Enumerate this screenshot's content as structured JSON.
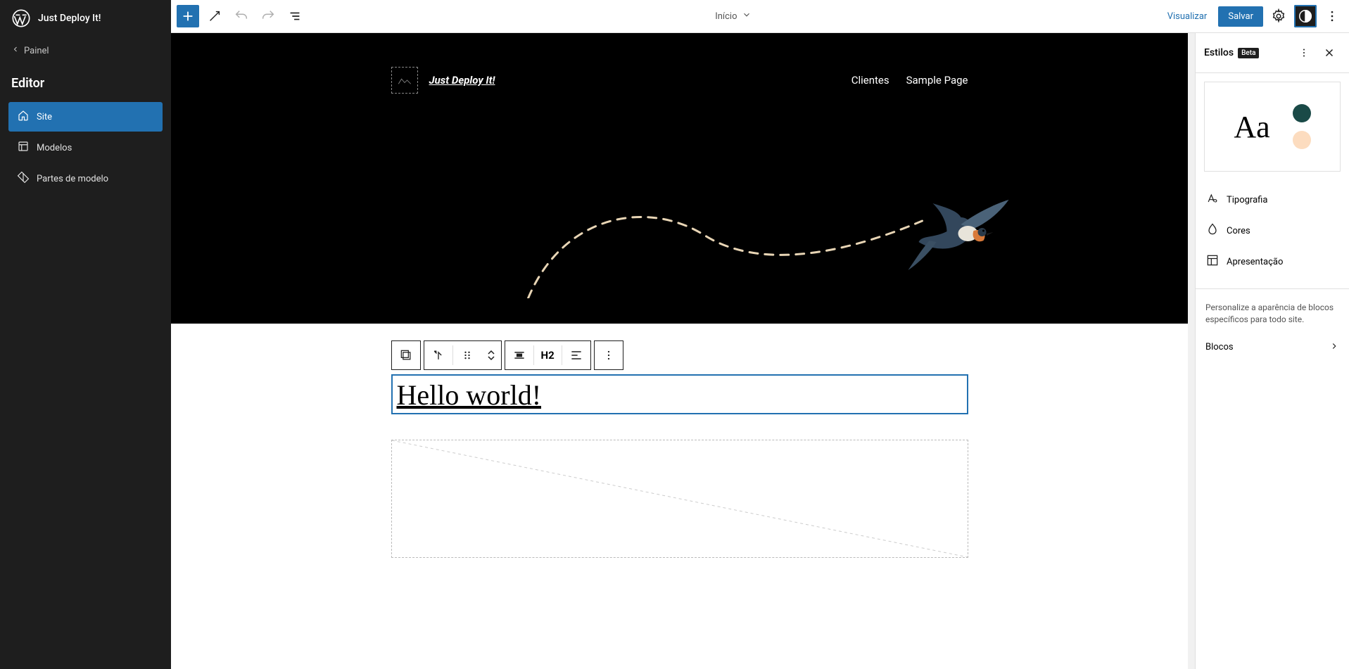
{
  "siteName": "Just Deploy It!",
  "backLabel": "Painel",
  "sectionTitle": "Editor",
  "nav": [
    {
      "label": "Site"
    },
    {
      "label": "Modelos"
    },
    {
      "label": "Partes de modelo"
    }
  ],
  "topbar": {
    "templateName": "Início",
    "preview": "Visualizar",
    "save": "Salvar"
  },
  "hero": {
    "siteTitle": "Just Deploy It!",
    "navItems": [
      "Clientes",
      "Sample Page"
    ]
  },
  "toolbar": {
    "headingLevel": "H2"
  },
  "content": {
    "heading": "Hello world!"
  },
  "styles": {
    "title": "Estilos",
    "badge": "Beta",
    "previewAa": "Aa",
    "swatchDark": "#1a4a47",
    "swatchLight": "#fcdcbf",
    "options": {
      "typography": "Tipografia",
      "colors": "Cores",
      "layout": "Apresentação"
    },
    "hint": "Personalize a aparência de blocos específicos para todo site.",
    "blocks": "Blocos"
  }
}
